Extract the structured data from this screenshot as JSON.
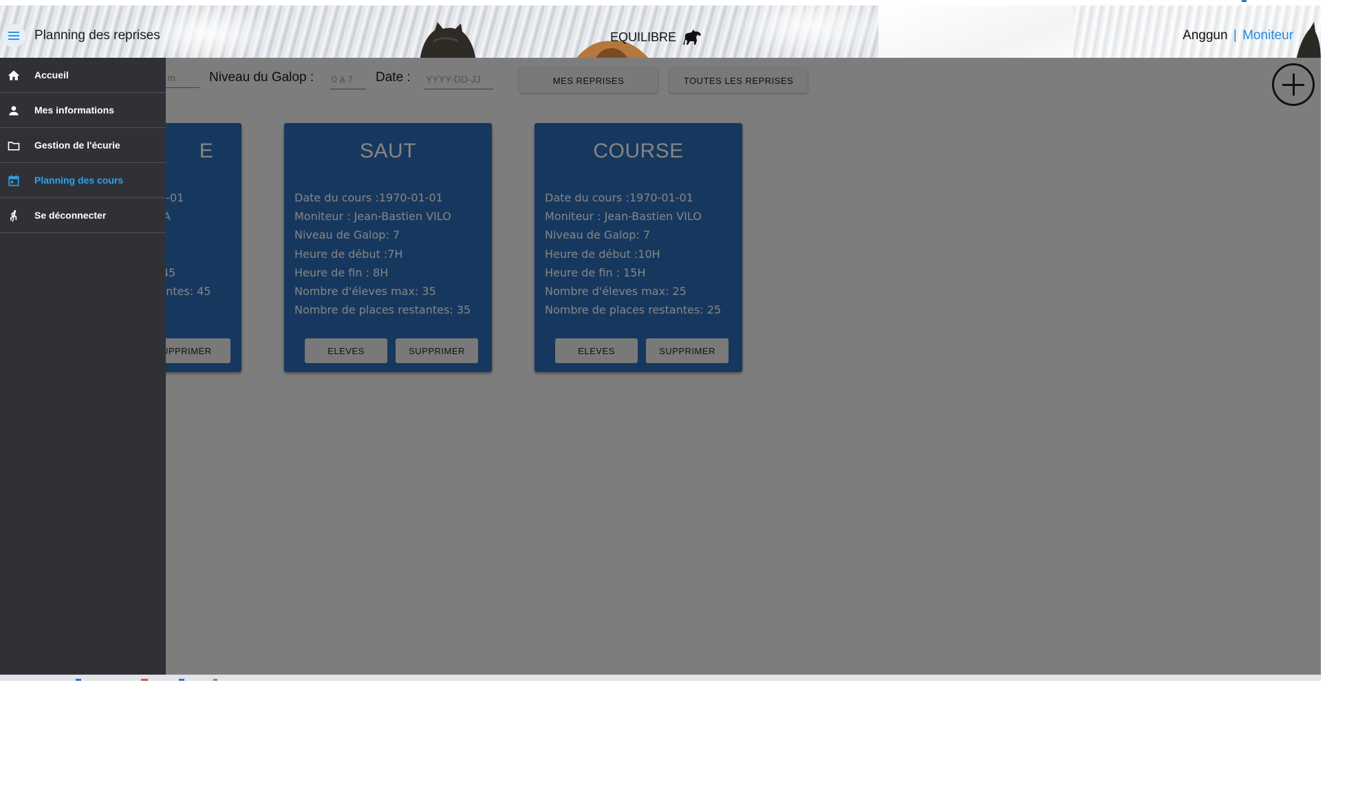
{
  "header": {
    "title": "Planning des reprises",
    "brand": "EQUILIBRE",
    "user_name": "Anggun",
    "separator": "|",
    "user_role": "Moniteur"
  },
  "sidebar": {
    "items": [
      {
        "label": "Accueil",
        "icon": "home-icon"
      },
      {
        "label": "Mes informations",
        "icon": "person-icon"
      },
      {
        "label": "Gestion de l'écurie",
        "icon": "folder-icon"
      },
      {
        "label": "Planning des cours",
        "icon": "calendar-icon",
        "active": true
      },
      {
        "label": "Se déconnecter",
        "icon": "run-icon"
      }
    ]
  },
  "filters": {
    "name_placeholder_visible": "m",
    "galop_label": "Niveau du Galop :",
    "galop_placeholder": "0 à 7",
    "date_label": "Date :",
    "date_placeholder": "YYYY-DD-JJ",
    "mes_reprises": "MES REPRISES",
    "toutes_reprises": "TOUTES LES REPRISES"
  },
  "cards": [
    {
      "title": "E",
      "lines": [
        "1-01",
        "A",
        "",
        "",
        " 45",
        "tantes: 45"
      ],
      "eleves": "",
      "supprimer": "UPPRIMER"
    },
    {
      "title": "SAUT",
      "lines": [
        "Date du cours :1970-01-01",
        "Moniteur : Jean-Bastien VILO",
        "Niveau de Galop: 7",
        "Heure de début :7H",
        "Heure de fin : 8H",
        "Nombre d'éleves max: 35",
        "Nombre de places restantes: 35"
      ],
      "eleves": "ELEVES",
      "supprimer": "SUPPRIMER"
    },
    {
      "title": "COURSE",
      "lines": [
        "Date du cours :1970-01-01",
        "Moniteur : Jean-Bastien VILO",
        "Niveau de Galop: 7",
        "Heure de début :10H",
        "Heure de fin : 15H",
        "Nombre d'éleves max: 25",
        "Nombre de places restantes: 25"
      ],
      "eleves": "ELEVES",
      "supprimer": "SUPPRIMER"
    }
  ],
  "colors": {
    "accent": "#29a3f0",
    "card": "#2c6bb4",
    "sidebar": "#303137"
  },
  "icons": {
    "menu": "menu-icon",
    "add": "add-circle-icon",
    "brand": "horse-icon"
  }
}
